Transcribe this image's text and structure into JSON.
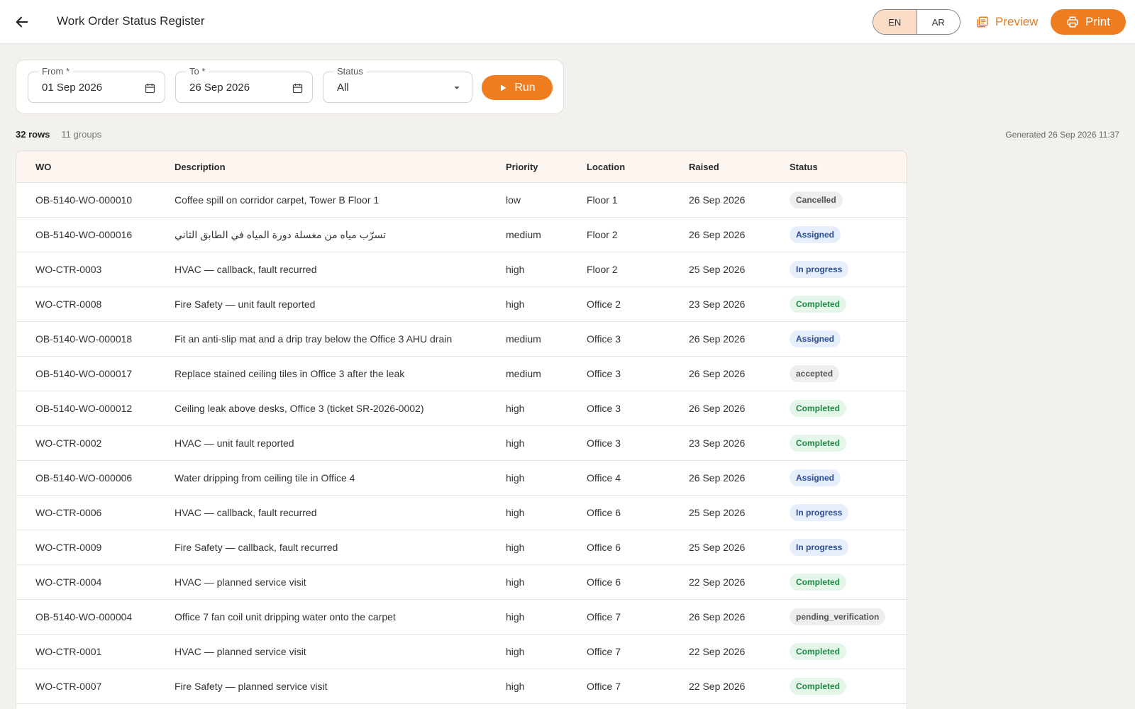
{
  "header": {
    "title": "Work Order Status Register",
    "lang": {
      "en": "EN",
      "ar": "AR",
      "active": "EN"
    },
    "preview_label": "Preview",
    "print_label": "Print",
    "accent": "#ef7d20"
  },
  "filters": {
    "from": {
      "label": "From *",
      "value": "01 Sep 2026"
    },
    "to": {
      "label": "To *",
      "value": "26 Sep 2026"
    },
    "status": {
      "label": "Status",
      "value": "All"
    },
    "run_label": "Run"
  },
  "summary": {
    "rows": "32 rows",
    "groups": "11 groups",
    "generated": "Generated 26 Sep 2026 11:37"
  },
  "table": {
    "columns": [
      "WO",
      "Description",
      "Priority",
      "Location",
      "Raised",
      "Status"
    ],
    "rows": [
      {
        "wo": "OB-5140-WO-000010",
        "desc": "Coffee spill on corridor carpet, Tower B Floor 1",
        "priority": "low",
        "location": "Floor 1",
        "raised": "26 Sep 2026",
        "status": "Cancelled",
        "kind": "cancelled"
      },
      {
        "wo": "OB-5140-WO-000016",
        "desc": "تسرّب مياه من مغسلة دورة المياه في الطابق الثاني",
        "priority": "medium",
        "location": "Floor 2",
        "raised": "26 Sep 2026",
        "status": "Assigned",
        "kind": "assigned",
        "rtl": true
      },
      {
        "wo": "WO-CTR-0003",
        "desc": "HVAC — callback, fault recurred",
        "priority": "high",
        "location": "Floor 2",
        "raised": "25 Sep 2026",
        "status": "In progress",
        "kind": "inprogress"
      },
      {
        "wo": "WO-CTR-0008",
        "desc": "Fire Safety — unit fault reported",
        "priority": "high",
        "location": "Office 2",
        "raised": "23 Sep 2026",
        "status": "Completed",
        "kind": "completed"
      },
      {
        "wo": "OB-5140-WO-000018",
        "desc": "Fit an anti-slip mat and a drip tray below the Office 3 AHU drain",
        "priority": "medium",
        "location": "Office 3",
        "raised": "26 Sep 2026",
        "status": "Assigned",
        "kind": "assigned"
      },
      {
        "wo": "OB-5140-WO-000017",
        "desc": "Replace stained ceiling tiles in Office 3 after the leak",
        "priority": "medium",
        "location": "Office 3",
        "raised": "26 Sep 2026",
        "status": "accepted",
        "kind": "neutral"
      },
      {
        "wo": "OB-5140-WO-000012",
        "desc": "Ceiling leak above desks, Office 3 (ticket SR-2026-0002)",
        "priority": "high",
        "location": "Office 3",
        "raised": "26 Sep 2026",
        "status": "Completed",
        "kind": "completed"
      },
      {
        "wo": "WO-CTR-0002",
        "desc": "HVAC — unit fault reported",
        "priority": "high",
        "location": "Office 3",
        "raised": "23 Sep 2026",
        "status": "Completed",
        "kind": "completed"
      },
      {
        "wo": "OB-5140-WO-000006",
        "desc": "Water dripping from ceiling tile in Office 4",
        "priority": "high",
        "location": "Office 4",
        "raised": "26 Sep 2026",
        "status": "Assigned",
        "kind": "assigned"
      },
      {
        "wo": "WO-CTR-0006",
        "desc": "HVAC — callback, fault recurred",
        "priority": "high",
        "location": "Office 6",
        "raised": "25 Sep 2026",
        "status": "In progress",
        "kind": "inprogress"
      },
      {
        "wo": "WO-CTR-0009",
        "desc": "Fire Safety — callback, fault recurred",
        "priority": "high",
        "location": "Office 6",
        "raised": "25 Sep 2026",
        "status": "In progress",
        "kind": "inprogress"
      },
      {
        "wo": "WO-CTR-0004",
        "desc": "HVAC — planned service visit",
        "priority": "high",
        "location": "Office 6",
        "raised": "22 Sep 2026",
        "status": "Completed",
        "kind": "completed"
      },
      {
        "wo": "OB-5140-WO-000004",
        "desc": "Office 7 fan coil unit dripping water onto the carpet",
        "priority": "high",
        "location": "Office 7",
        "raised": "26 Sep 2026",
        "status": "pending_verification",
        "kind": "neutral"
      },
      {
        "wo": "WO-CTR-0001",
        "desc": "HVAC — planned service visit",
        "priority": "high",
        "location": "Office 7",
        "raised": "22 Sep 2026",
        "status": "Completed",
        "kind": "completed"
      },
      {
        "wo": "WO-CTR-0007",
        "desc": "Fire Safety — planned service visit",
        "priority": "high",
        "location": "Office 7",
        "raised": "22 Sep 2026",
        "status": "Completed",
        "kind": "completed"
      }
    ]
  }
}
